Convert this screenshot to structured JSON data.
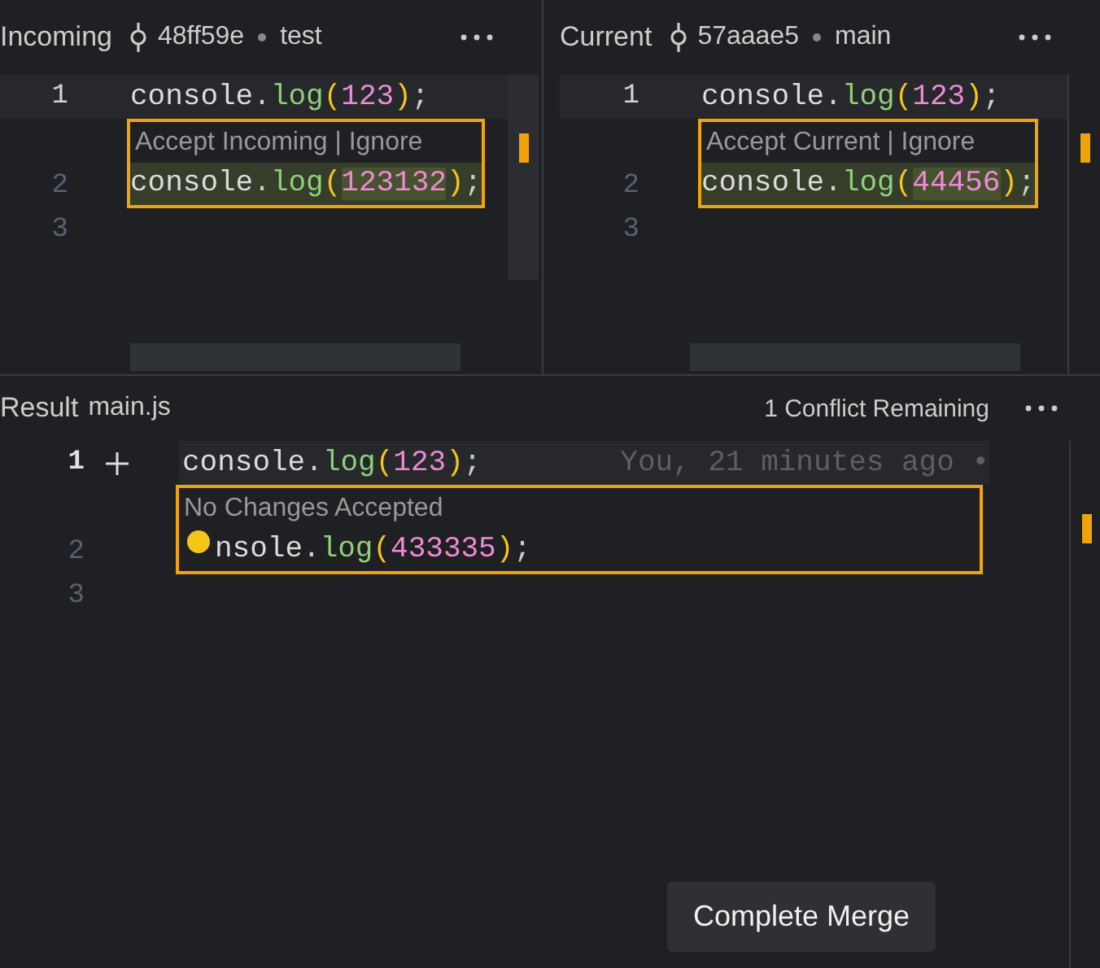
{
  "panes": [
    {
      "title": "Incoming",
      "commit": "48ff59e",
      "branch": "test",
      "rows": [
        {
          "kind": "code",
          "number": "1",
          "tokens": [
            {
              "kind": "ident",
              "text": "console"
            },
            {
              "kind": "punct",
              "text": "."
            },
            {
              "kind": "func",
              "text": "log"
            },
            {
              "kind": "paren",
              "text": "("
            },
            {
              "kind": "number",
              "text": "123"
            },
            {
              "kind": "paren",
              "text": ")"
            },
            {
              "kind": "punct",
              "text": ";"
            }
          ]
        },
        {
          "kind": "conflict",
          "label": "Accept Incoming | Ignore",
          "number": "2",
          "tokens": [
            {
              "kind": "ident",
              "text": "console"
            },
            {
              "kind": "punct",
              "text": "."
            },
            {
              "kind": "func",
              "text": "log"
            },
            {
              "kind": "paren",
              "text": "("
            },
            {
              "kind": "number",
              "text": "123132"
            },
            {
              "kind": "paren",
              "text": ")"
            },
            {
              "kind": "punct",
              "text": ";"
            }
          ]
        },
        {
          "kind": "code",
          "number": "3",
          "tokens": []
        }
      ]
    },
    {
      "title": "Current",
      "commit": "57aaae5",
      "branch": "main",
      "rows": [
        {
          "kind": "code",
          "number": "1",
          "tokens": [
            {
              "kind": "ident",
              "text": "console"
            },
            {
              "kind": "punct",
              "text": "."
            },
            {
              "kind": "func",
              "text": "log"
            },
            {
              "kind": "paren",
              "text": "("
            },
            {
              "kind": "number",
              "text": "123"
            },
            {
              "kind": "paren",
              "text": ")"
            },
            {
              "kind": "punct",
              "text": ";"
            }
          ]
        },
        {
          "kind": "conflict",
          "label": "Accept Current | Ignore",
          "number": "2",
          "tokens": [
            {
              "kind": "ident",
              "text": "console"
            },
            {
              "kind": "punct",
              "text": "."
            },
            {
              "kind": "func",
              "text": "log"
            },
            {
              "kind": "paren",
              "text": "("
            },
            {
              "kind": "number",
              "text": "44456"
            },
            {
              "kind": "paren",
              "text": ")"
            },
            {
              "kind": "punct",
              "text": ";"
            }
          ]
        },
        {
          "kind": "code",
          "number": "3",
          "tokens": []
        }
      ]
    }
  ],
  "result": {
    "title": "Result",
    "file": "main.js",
    "status": "1 Conflict Remaining",
    "rows": [
      {
        "kind": "code",
        "number": "1",
        "blame": "You, 21 minutes ago •",
        "tokens": [
          {
            "kind": "ident",
            "text": "console"
          },
          {
            "kind": "punct",
            "text": "."
          },
          {
            "kind": "func",
            "text": "log"
          },
          {
            "kind": "paren",
            "text": "("
          },
          {
            "kind": "number",
            "text": "123"
          },
          {
            "kind": "paren",
            "text": ")"
          },
          {
            "kind": "punct",
            "text": ";"
          }
        ]
      },
      {
        "kind": "conflict",
        "label": "No Changes Accepted",
        "number": "2",
        "tokens": [
          {
            "kind": "ident",
            "text": "nsole"
          },
          {
            "kind": "punct",
            "text": "."
          },
          {
            "kind": "func",
            "text": "log"
          },
          {
            "kind": "paren",
            "text": "("
          },
          {
            "kind": "number",
            "text": "433335"
          },
          {
            "kind": "paren",
            "text": ")"
          },
          {
            "kind": "punct",
            "text": ";"
          }
        ]
      },
      {
        "kind": "code",
        "number": "3",
        "tokens": []
      }
    ]
  },
  "button": "Complete Merge"
}
